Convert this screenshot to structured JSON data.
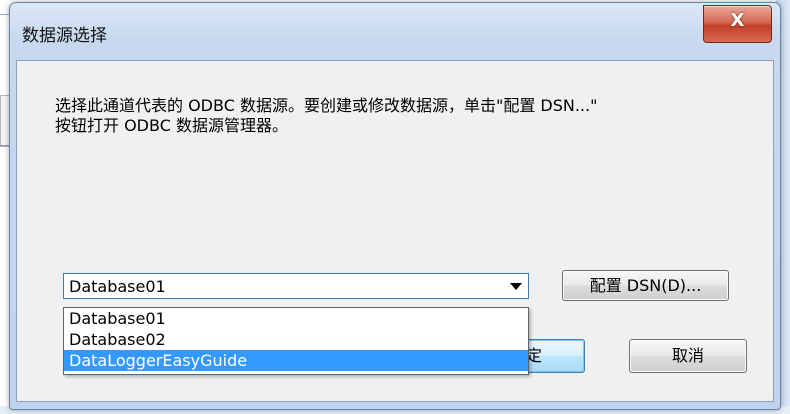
{
  "dialog": {
    "title": "数据源选择",
    "close_label": "X",
    "description_line1": "选择此通道代表的 ODBC 数据源。要创建或修改数据源，单击\"配置 DSN...\"",
    "description_line2": "按钮打开 ODBC 数据源管理器。"
  },
  "datasource": {
    "selected": "Database01",
    "options": [
      "Database01",
      "Database02",
      "DataLoggerEasyGuide"
    ],
    "highlighted_index": 2
  },
  "buttons": {
    "config_label": "配置 DSN(D)...",
    "ok_label": "确定",
    "cancel_label": "取消"
  }
}
